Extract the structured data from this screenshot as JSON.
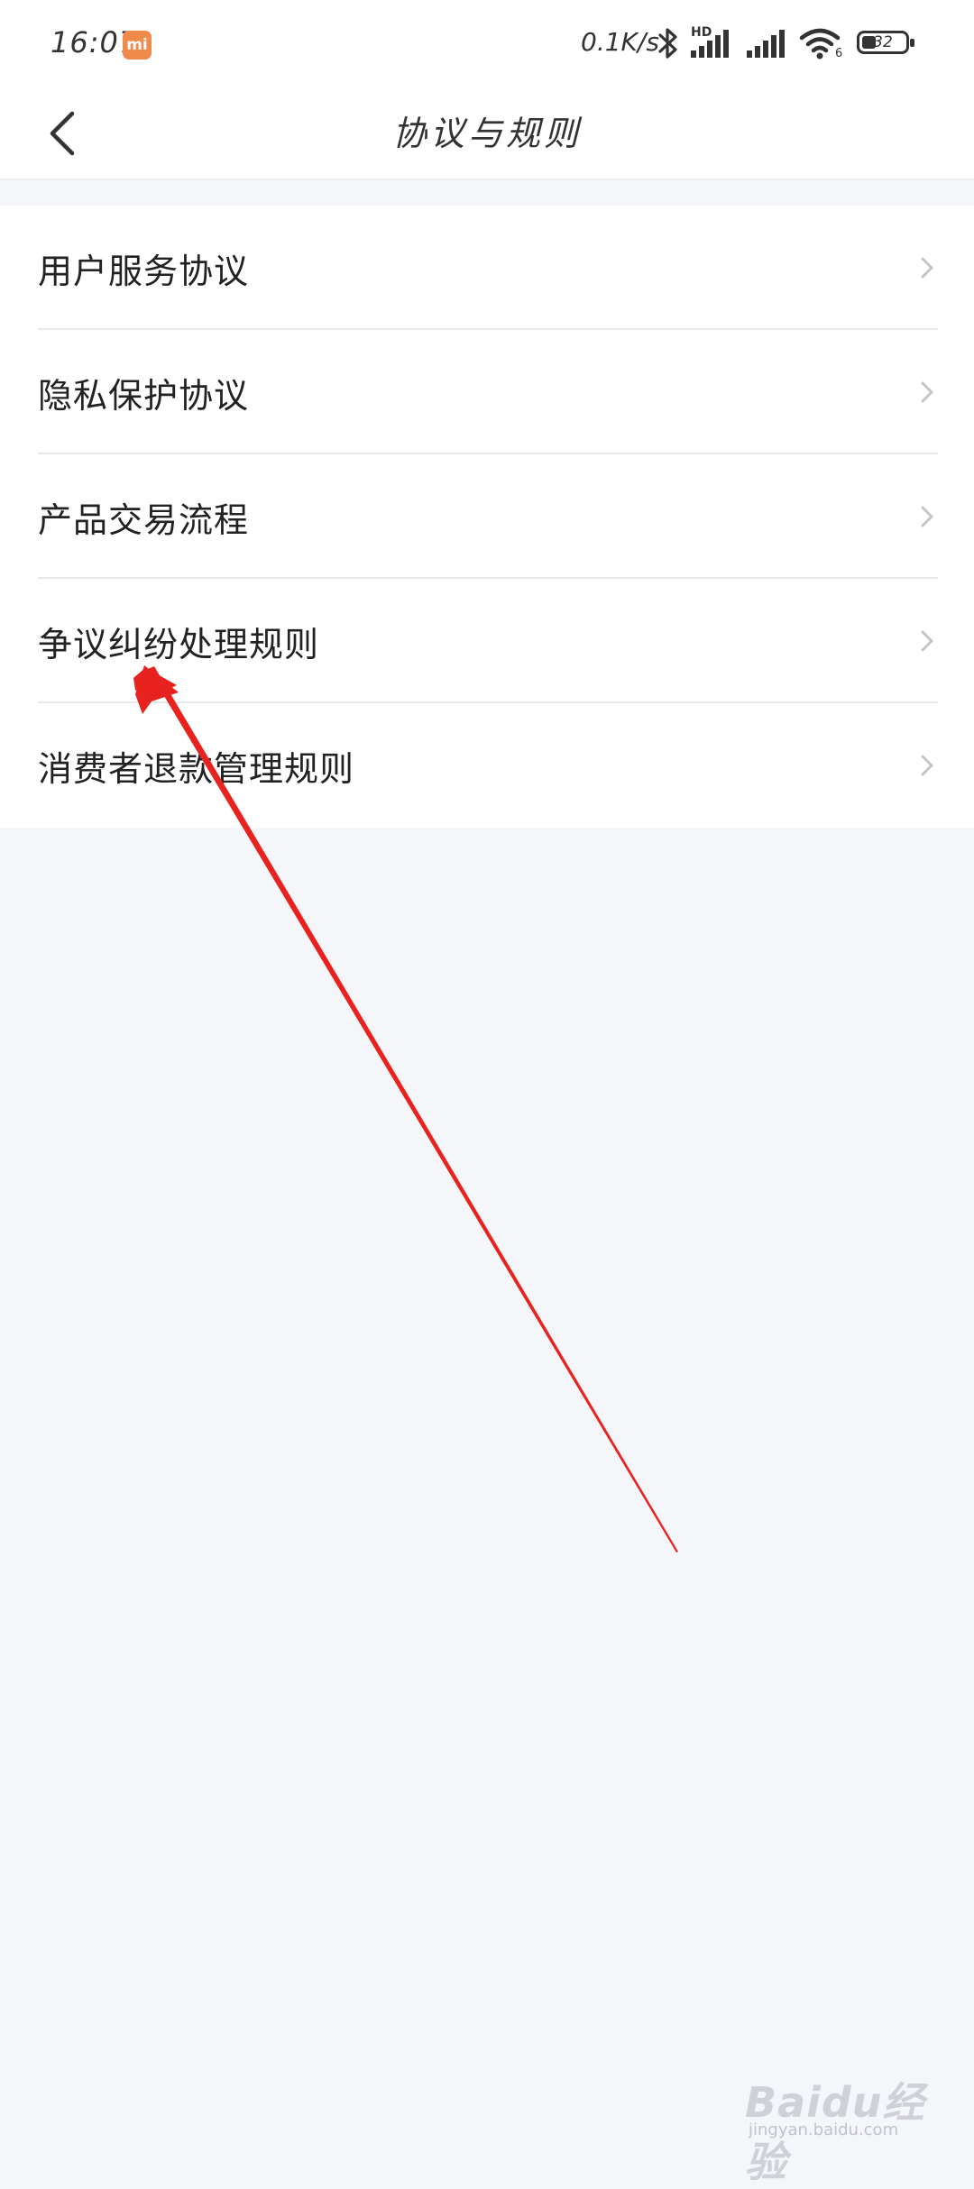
{
  "status_bar": {
    "time": "16:07",
    "mi_badge": "mi",
    "net_speed": "0.1K/s",
    "hd_label": "HD",
    "wifi_sub": "6",
    "battery_level": "32"
  },
  "nav": {
    "title": "协议与规则"
  },
  "list": {
    "items": [
      {
        "label": "用户服务协议"
      },
      {
        "label": "隐私保护协议"
      },
      {
        "label": "产品交易流程"
      },
      {
        "label": "争议纠纷处理规则"
      },
      {
        "label": "消费者退款管理规则"
      }
    ]
  },
  "watermark": {
    "brand": "Baidu经验",
    "url": "jingyan.baidu.com"
  },
  "colors": {
    "background": "#f5f6fa",
    "surface": "#ffffff",
    "annotation_arrow": "#e8231f"
  }
}
